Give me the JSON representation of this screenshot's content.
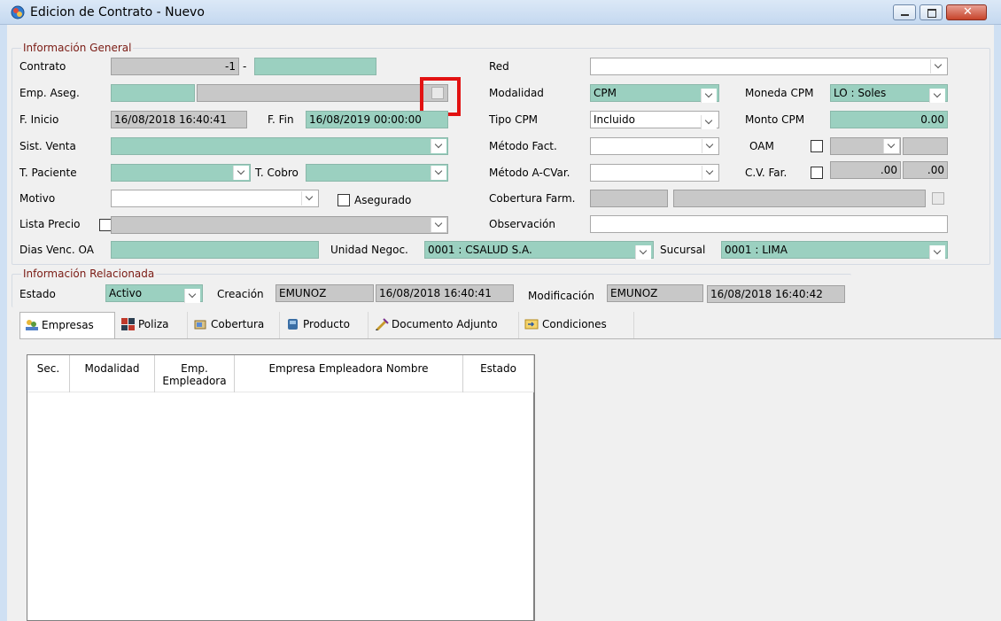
{
  "window": {
    "title": "Edicion de Contrato - Nuevo"
  },
  "general": {
    "legend": "Información General",
    "contrato": {
      "label": "Contrato",
      "value": "-1",
      "sep": "-"
    },
    "emp_aseg": {
      "label": "Emp. Aseg."
    },
    "f_inicio": {
      "label": "F. Inicio",
      "value": "16/08/2018 16:40:41"
    },
    "f_fin": {
      "label": "F. Fin",
      "value": "16/08/2019 00:00:00"
    },
    "sist_venta": {
      "label": "Sist. Venta"
    },
    "t_paciente": {
      "label": "T. Paciente"
    },
    "t_cobro": {
      "label": "T. Cobro"
    },
    "motivo": {
      "label": "Motivo"
    },
    "asegurado": {
      "label": "Asegurado"
    },
    "lista_precio": {
      "label": "Lista Precio"
    },
    "dias_venc": {
      "label": "Dias Venc. OA"
    },
    "unidad_negoc": {
      "label": "Unidad Negoc.",
      "value": "0001 : CSALUD S.A."
    },
    "sucursal": {
      "label": "Sucursal",
      "value": "0001 : LIMA"
    },
    "red": {
      "label": "Red"
    },
    "modalidad": {
      "label": "Modalidad",
      "value": "CPM"
    },
    "moneda_cpm": {
      "label": "Moneda CPM",
      "value": "LO : Soles"
    },
    "tipo_cpm": {
      "label": "Tipo CPM",
      "value": "Incluido"
    },
    "monto_cpm": {
      "label": "Monto CPM",
      "value": "0.00"
    },
    "metodo_fact": {
      "label": "Método Fact."
    },
    "oam": {
      "label": "OAM"
    },
    "metodo_acvar": {
      "label": "Método A-CVar."
    },
    "cv_far": {
      "label": "C.V. Far.",
      "value1": ".00",
      "value2": ".00"
    },
    "cobertura_farm": {
      "label": "Cobertura Farm."
    },
    "observacion": {
      "label": "Observación"
    }
  },
  "related": {
    "legend": "Información Relacionada",
    "estado": {
      "label": "Estado",
      "value": "Activo"
    },
    "creacion": {
      "label": "Creación",
      "user": "EMUNOZ",
      "date": "16/08/2018 16:40:41"
    },
    "modificacion": {
      "label": "Modificación",
      "user": "EMUNOZ",
      "date": "16/08/2018 16:40:42"
    }
  },
  "tabs": [
    {
      "label": "Empresas",
      "icon": "companies-icon"
    },
    {
      "label": "Poliza",
      "icon": "policy-icon"
    },
    {
      "label": "Cobertura",
      "icon": "coverage-icon"
    },
    {
      "label": "Producto",
      "icon": "product-icon"
    },
    {
      "label": "Documento Adjunto",
      "icon": "attachment-icon"
    },
    {
      "label": "Condiciones",
      "icon": "conditions-icon"
    }
  ],
  "grid": {
    "columns": [
      "Sec.",
      "Modalidad",
      "Emp. Empleadora",
      "Empresa Empleadora Nombre",
      "Estado"
    ]
  }
}
